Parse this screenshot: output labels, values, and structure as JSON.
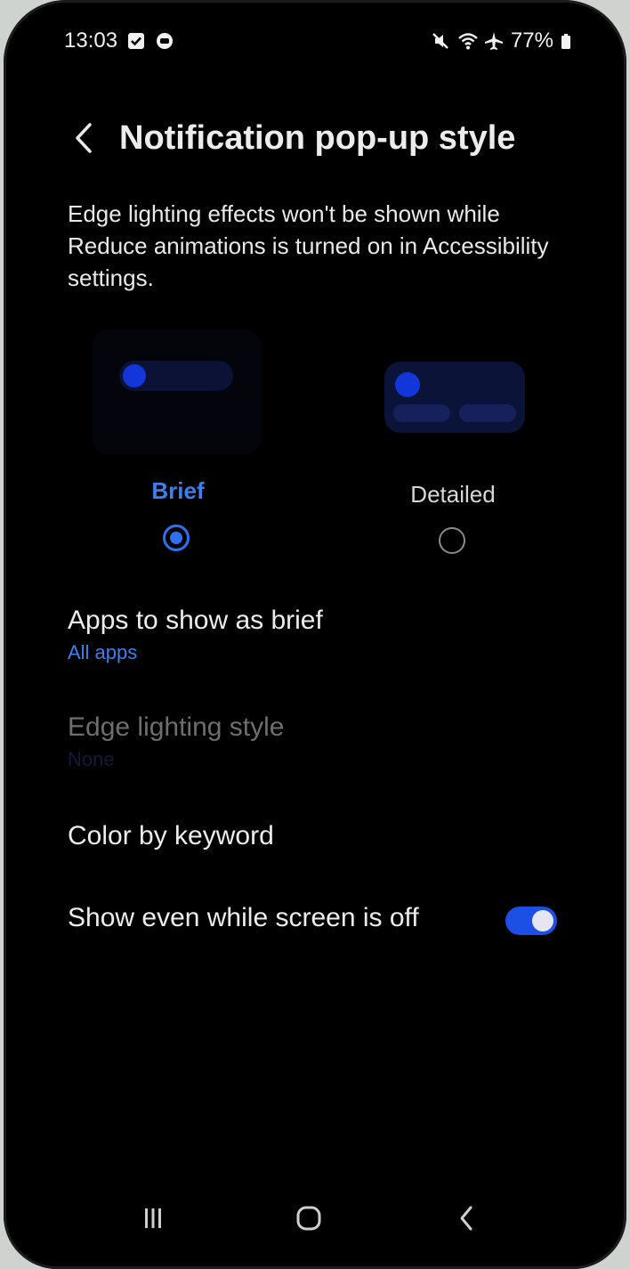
{
  "status_bar": {
    "time": "13:03",
    "battery": "77%",
    "icons_left": [
      "task-check-icon",
      "app-circle-icon"
    ],
    "icons_right": [
      "mute-icon",
      "wifi-icon",
      "airplane-icon",
      "battery-icon"
    ]
  },
  "header": {
    "title": "Notification pop-up style",
    "back_icon": "chevron-left-icon"
  },
  "notice": "Edge lighting effects won't be shown while Reduce animations is turned on in Accessibility settings.",
  "styles": {
    "brief_label": "Brief",
    "detailed_label": "Detailed",
    "selected": "Brief"
  },
  "settings": {
    "apps_title": "Apps to show as brief",
    "apps_value": "All apps",
    "edge_title": "Edge lighting style",
    "edge_value": "None",
    "color_title": "Color by keyword",
    "screen_off_title": "Show even while screen is off",
    "screen_off_enabled": true
  },
  "nav": {
    "items": [
      "recent-apps-icon",
      "home-icon",
      "back-icon"
    ]
  },
  "colors": {
    "accent": "#3c7ff0",
    "toggle_on": "#1c4fe6",
    "background": "#000000"
  }
}
